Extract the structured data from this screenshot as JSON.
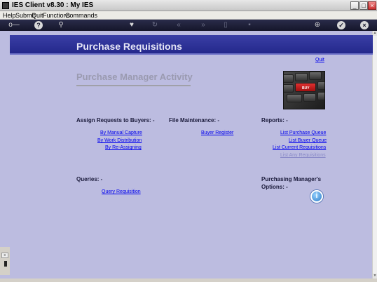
{
  "window": {
    "title": "IES Client v8.30 : My IES"
  },
  "menu": {
    "items": [
      "Help",
      "Submit",
      "Quit",
      "Functions",
      "Commands"
    ]
  },
  "header": {
    "title": "Purchase Requisitions",
    "quit_label": "Quit"
  },
  "activity_title": "Purchase Manager Activity",
  "image": {
    "key_label": "BUY"
  },
  "assign": {
    "heading": "Assign Requests to Buyers: -",
    "links": [
      "By Manual Capture",
      "By Work Distribution",
      "By Re-Assigning"
    ]
  },
  "file_maintenance": {
    "heading": "File Maintenance: -",
    "links": [
      "Buyer Register"
    ]
  },
  "reports": {
    "heading": "Reports: -",
    "links": [
      "List Purchase Queue",
      "List Buyer Queue",
      "List Current Requisitions",
      "List Any Requisitions"
    ]
  },
  "queries": {
    "heading": "Queries: -",
    "links": [
      "Query Requisition"
    ]
  },
  "manager_options": {
    "heading_line1": "Purchasing Manager's",
    "heading_line2": "Options: -",
    "info_glyph": "i"
  },
  "icons": {
    "toolbar": [
      "key-icon",
      "help-icon",
      "search-icon",
      "favorite-icon",
      "refresh-icon",
      "back-icon",
      "forward-icon",
      "document-icon",
      "print-icon",
      "globe-icon",
      "confirm-icon",
      "close-icon"
    ]
  }
}
